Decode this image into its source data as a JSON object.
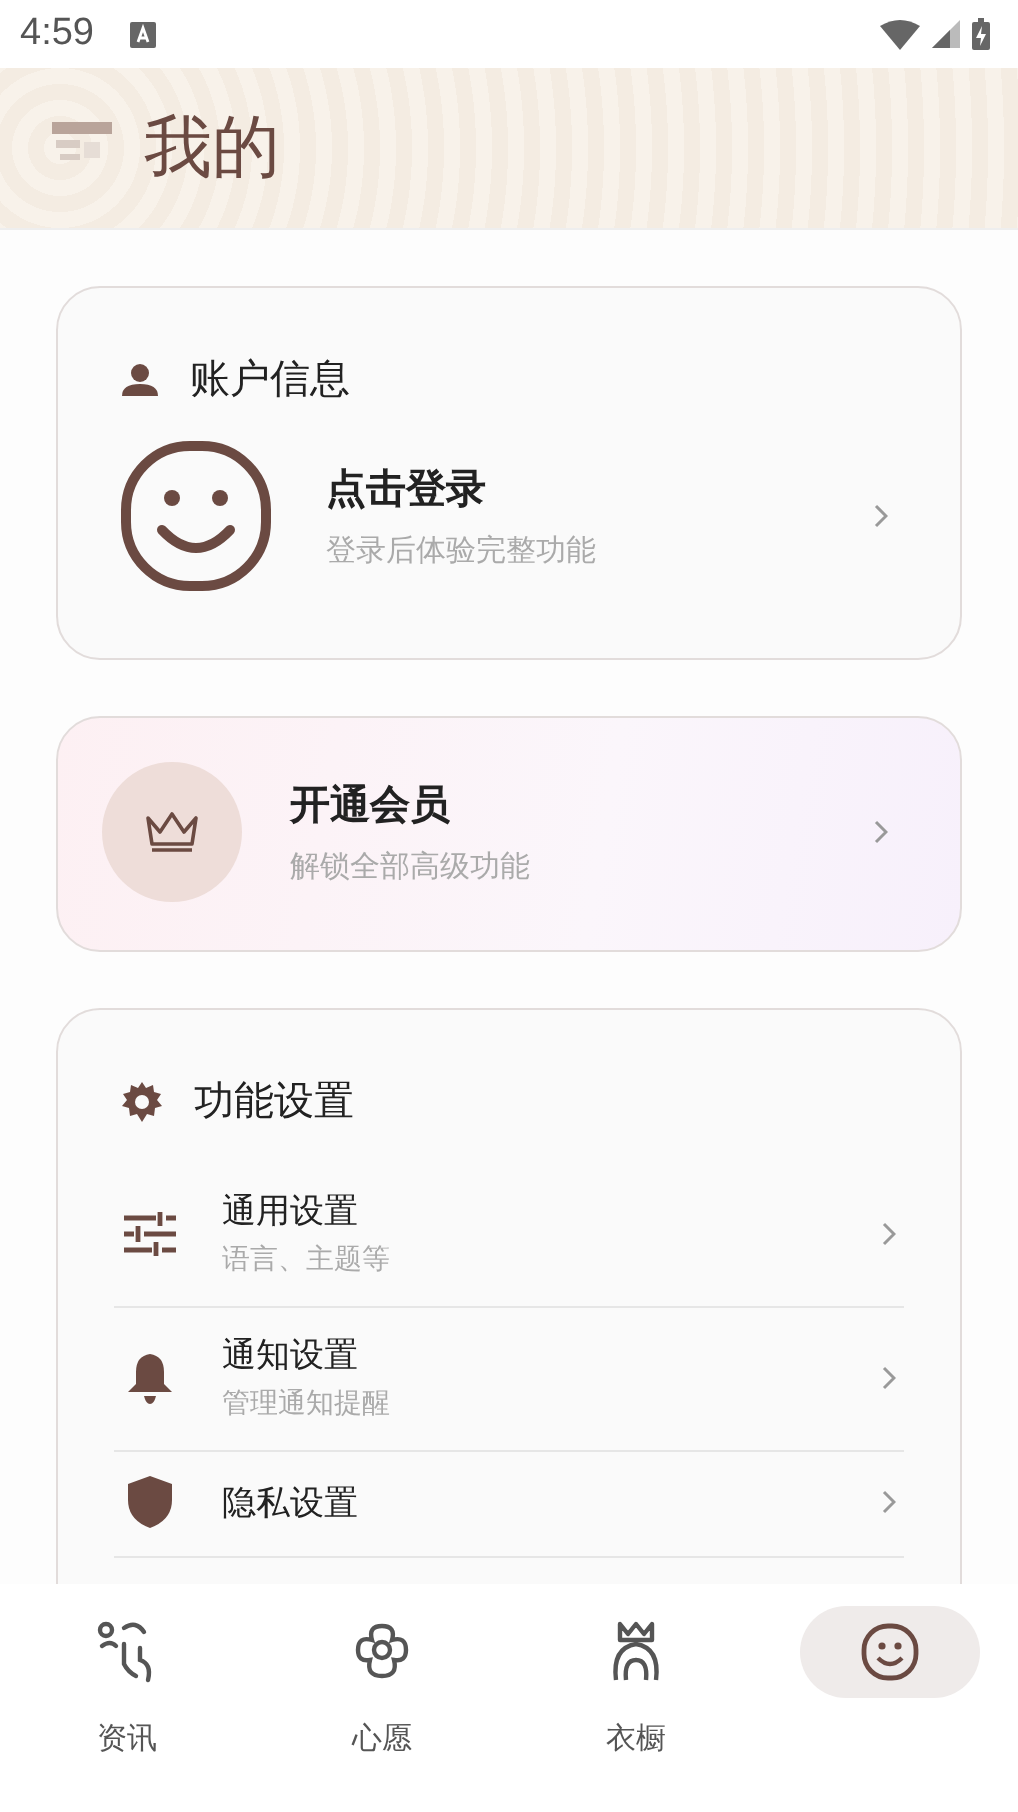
{
  "status_bar": {
    "time": "4:59"
  },
  "header": {
    "title": "我的"
  },
  "account": {
    "title": "账户信息",
    "login": "点击登录",
    "hint": "登录后体验完整功能"
  },
  "vip": {
    "title": "开通会员",
    "subtitle": "解锁全部高级功能"
  },
  "settings": {
    "title": "功能设置",
    "items": [
      {
        "kind": "sliders",
        "title": "通用设置",
        "subtitle": "语言、主题等"
      },
      {
        "kind": "bell",
        "title": "通知设置",
        "subtitle": "管理通知提醒"
      },
      {
        "kind": "shield",
        "title": "隐私设置"
      }
    ]
  },
  "nav": [
    {
      "kind": "news",
      "label": "资讯",
      "selected": false
    },
    {
      "kind": "flower",
      "label": "心愿",
      "selected": false
    },
    {
      "kind": "wardrobe",
      "label": "衣橱",
      "selected": false
    },
    {
      "kind": "me",
      "selected": true
    }
  ]
}
